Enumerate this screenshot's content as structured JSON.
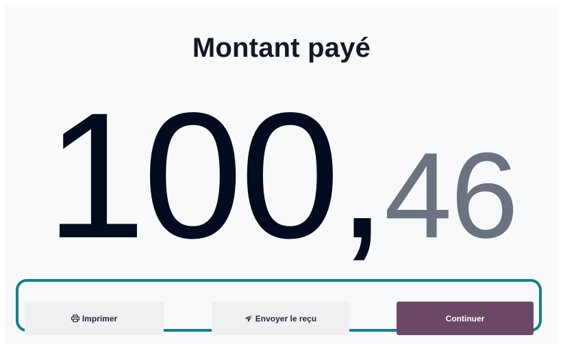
{
  "title": "Montant payé",
  "amount": {
    "integer": "100,",
    "decimal": "46"
  },
  "actions": {
    "print_label": "Imprimer",
    "print_icon": "printer-icon",
    "send_label": "Envoyer le reçu",
    "send_icon": "paper-plane-icon",
    "continue_label": "Continuer"
  },
  "colors": {
    "primary": "#6b4865",
    "focus_ring": "#147f89",
    "amount_integer": "#030c1e",
    "amount_decimal": "#6b7280"
  }
}
